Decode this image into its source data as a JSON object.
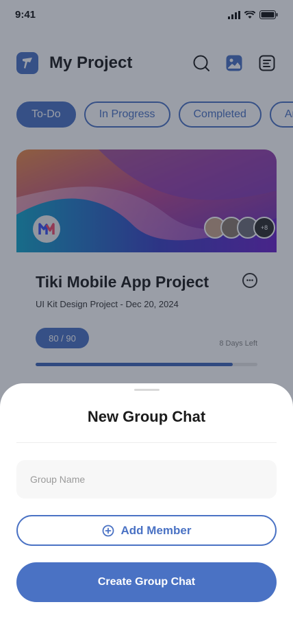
{
  "status_bar": {
    "time": "9:41"
  },
  "header": {
    "title": "My Project"
  },
  "tabs": [
    {
      "label": "To-Do",
      "active": true
    },
    {
      "label": "In Progress",
      "active": false
    },
    {
      "label": "Completed",
      "active": false
    },
    {
      "label": "Archived",
      "active": false
    }
  ],
  "project_card": {
    "title": "Tiki Mobile App Project",
    "subtitle": "UI Kit Design Project - Dec 20, 2024",
    "progress_label": "80 / 90",
    "progress_fraction": 0.889,
    "days_left": "8 Days Left",
    "extra_members": "+8"
  },
  "sheet": {
    "title": "New Group Chat",
    "group_name_placeholder": "Group Name",
    "add_member_label": "Add Member",
    "create_label": "Create Group Chat"
  },
  "colors": {
    "accent": "#4a72c4",
    "overlay": "#1e283c"
  }
}
